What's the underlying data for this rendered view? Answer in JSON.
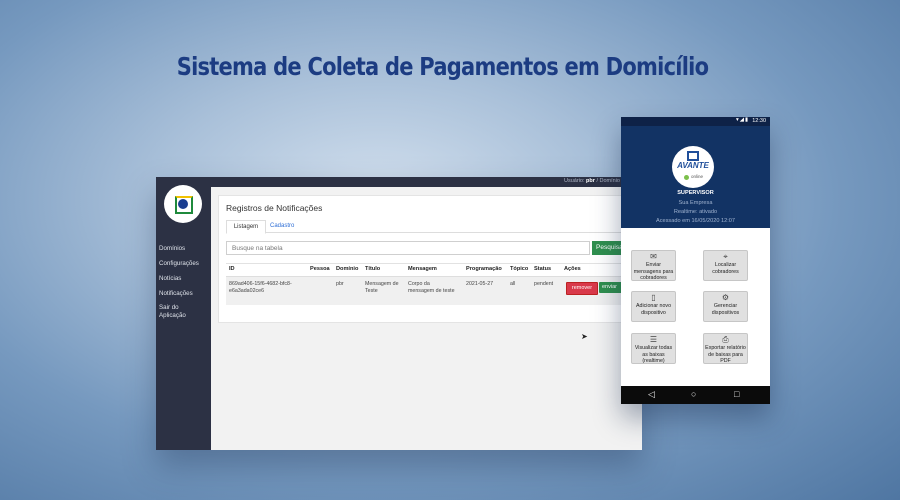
{
  "headline": "Sistema de Coleta de Pagamentos em Domicílio",
  "desktop": {
    "topbar": {
      "user_prefix": "Usuário:",
      "user": "pbr",
      "domain_suffix": "/ Domínio"
    },
    "sidebar": {
      "items": [
        "Domínios",
        "Configurações",
        "Notícias",
        "Notificações",
        "Sair do Aplicação"
      ]
    },
    "page_title": "Registros de Notificações",
    "tabs": [
      "Listagem",
      "Cadastro"
    ],
    "search": {
      "placeholder": "Busque na tabela",
      "button": "Pesquisar"
    },
    "table": {
      "headers": [
        "ID",
        "Pessoa",
        "Domínio",
        "Título",
        "Mensagem",
        "Programação",
        "Tópico",
        "Status",
        "Ações"
      ],
      "rows": [
        {
          "id": "869ad406-15f6-4682-bfc8-e6a3ada02ce6",
          "pessoa": "",
          "dominio": "pbr",
          "titulo": "Mensagem de Teste",
          "mensagem": "Corpo da mensagem de teste",
          "programacao": "2021-05-27",
          "topico": "all",
          "status": "pendent",
          "actions": [
            "remover",
            "enviar"
          ]
        }
      ]
    }
  },
  "phone": {
    "status": {
      "time": "12:30",
      "icons": "▾◢▮"
    },
    "logo": {
      "brand": "AVANTE",
      "tag": "online"
    },
    "role": "SUPERVISOR",
    "company": "Sua Empresa",
    "realtime": "Realtime: ativado",
    "accessed": "Acessado em 16/05/2020 12:07",
    "buttons": [
      {
        "label": "Enviar mensagens para cobradores",
        "icon": "✉"
      },
      {
        "label": "Localizar cobradores",
        "icon": "⌖"
      },
      {
        "label": "Adicionar novo dispositivo",
        "icon": "▯"
      },
      {
        "label": "Gerenciar dispositivos",
        "icon": "⚙"
      },
      {
        "label": "Visualizar todas as baixas (realtime)",
        "icon": "☰"
      },
      {
        "label": "Exportar relatório de baixas para PDF",
        "icon": "⎙"
      }
    ],
    "nav": {
      "back": "◁",
      "home": "○",
      "recent": "□"
    }
  },
  "colors": {
    "headline": "#1c3c82",
    "sidebar": "#2c3144",
    "phone_header": "#123364",
    "green_button": "#2f8f4e",
    "red_button": "#d9394a"
  }
}
